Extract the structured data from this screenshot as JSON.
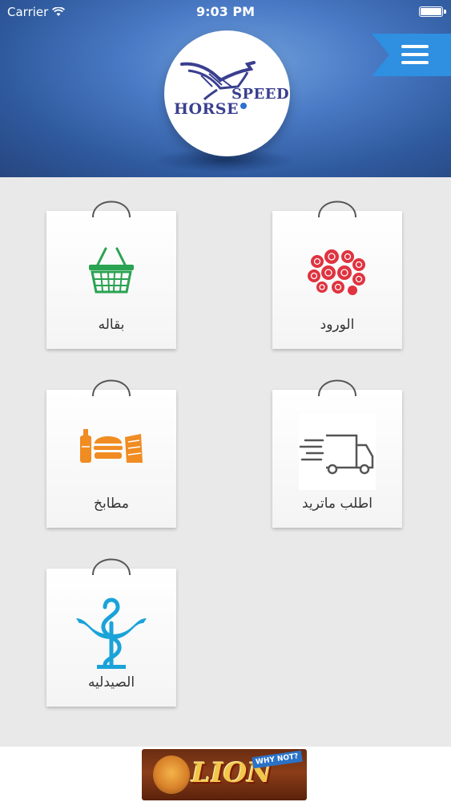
{
  "status_bar": {
    "carrier": "Carrier",
    "time": "9:03 PM",
    "battery_level": 1.0
  },
  "header": {
    "logo_text_top": "SPEED",
    "logo_text_bottom": "HORSE",
    "menu_icon": "hamburger-menu-icon",
    "accent_color": "#2f8fe0"
  },
  "categories": [
    {
      "label": "الورود",
      "icon": "flowers-icon"
    },
    {
      "label": "بقاله",
      "icon": "grocery-basket-icon"
    },
    {
      "label": "اطلب ماتريد",
      "icon": "delivery-truck-icon"
    },
    {
      "label": "مطابخ",
      "icon": "fast-food-icon"
    },
    {
      "label": "الصيدليه",
      "icon": "pharmacy-icon"
    }
  ],
  "ad": {
    "brand": "LION",
    "tag": "WHY NOT?"
  }
}
